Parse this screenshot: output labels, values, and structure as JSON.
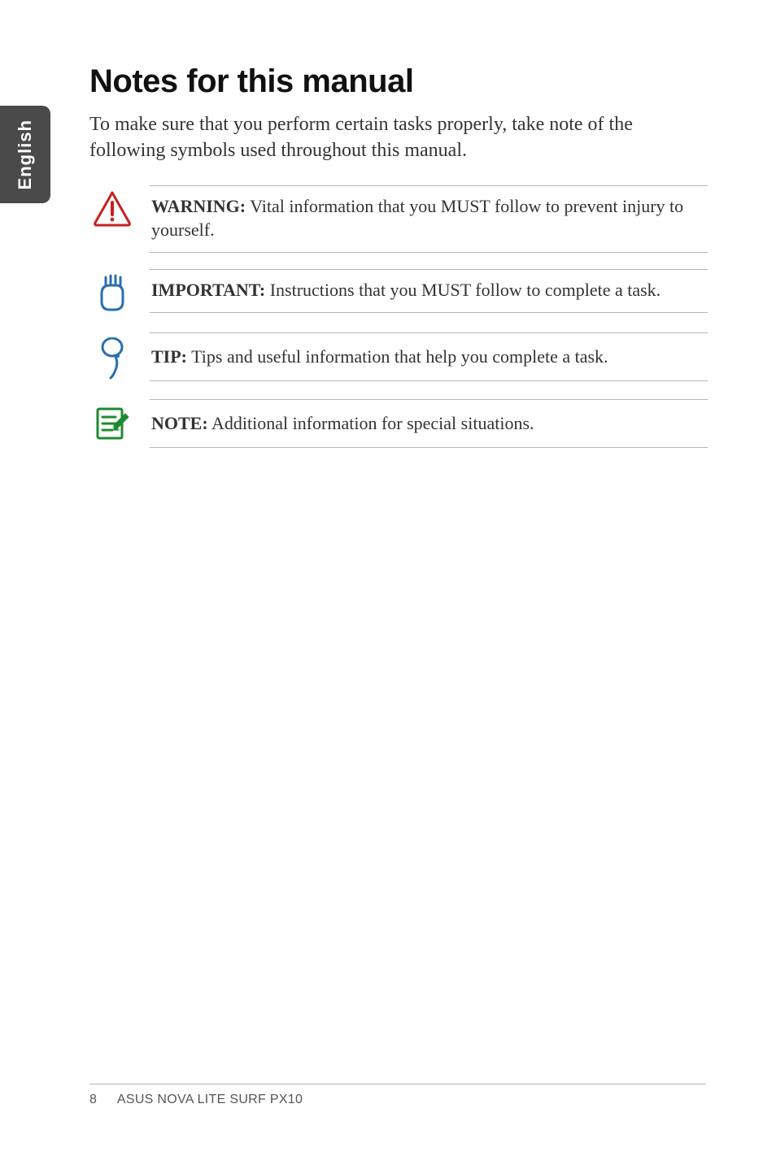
{
  "sideTab": {
    "label": "English"
  },
  "heading": "Notes for this manual",
  "intro": "To make sure that you perform certain tasks properly, take note of the following symbols used throughout this manual.",
  "callouts": {
    "warning": {
      "label": "WARNING:",
      "text": " Vital information that you MUST follow to prevent injury to yourself."
    },
    "important": {
      "label": "IMPORTANT:",
      "text": " Instructions that you MUST follow to complete a task."
    },
    "tip": {
      "label": "TIP:",
      "text": " Tips and useful information that help you complete a task."
    },
    "note": {
      "label": "NOTE:",
      "text": " Additional information for special situations."
    }
  },
  "footer": {
    "pageNumber": "8",
    "title": "ASUS NOVA LITE SURF PX10"
  }
}
